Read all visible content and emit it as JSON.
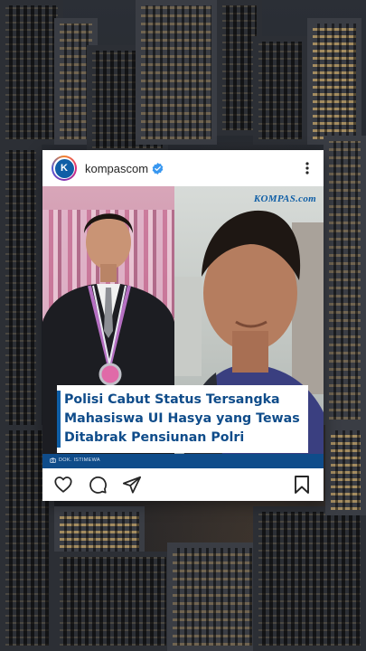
{
  "post": {
    "account": {
      "username": "kompascom",
      "avatar_letter": "K",
      "verified_icon": "verified-badge-icon"
    },
    "image": {
      "watermark": "KOMPAS.com",
      "headline": "Polisi Cabut Status Tersangka Mahasiswa UI Hasya yang Tewas Ditabrak Pensiunan Polri",
      "credit": "DOK. ISTIMEWA"
    },
    "actions": {
      "like_icon": "heart-icon",
      "comment_icon": "comment-icon",
      "share_icon": "share-icon",
      "save_icon": "bookmark-icon",
      "more_icon": "more-options-icon"
    }
  },
  "colors": {
    "brand_blue": "#0f5ea6",
    "headline_blue": "#0f4c8a",
    "verified_blue": "#3897f0"
  }
}
